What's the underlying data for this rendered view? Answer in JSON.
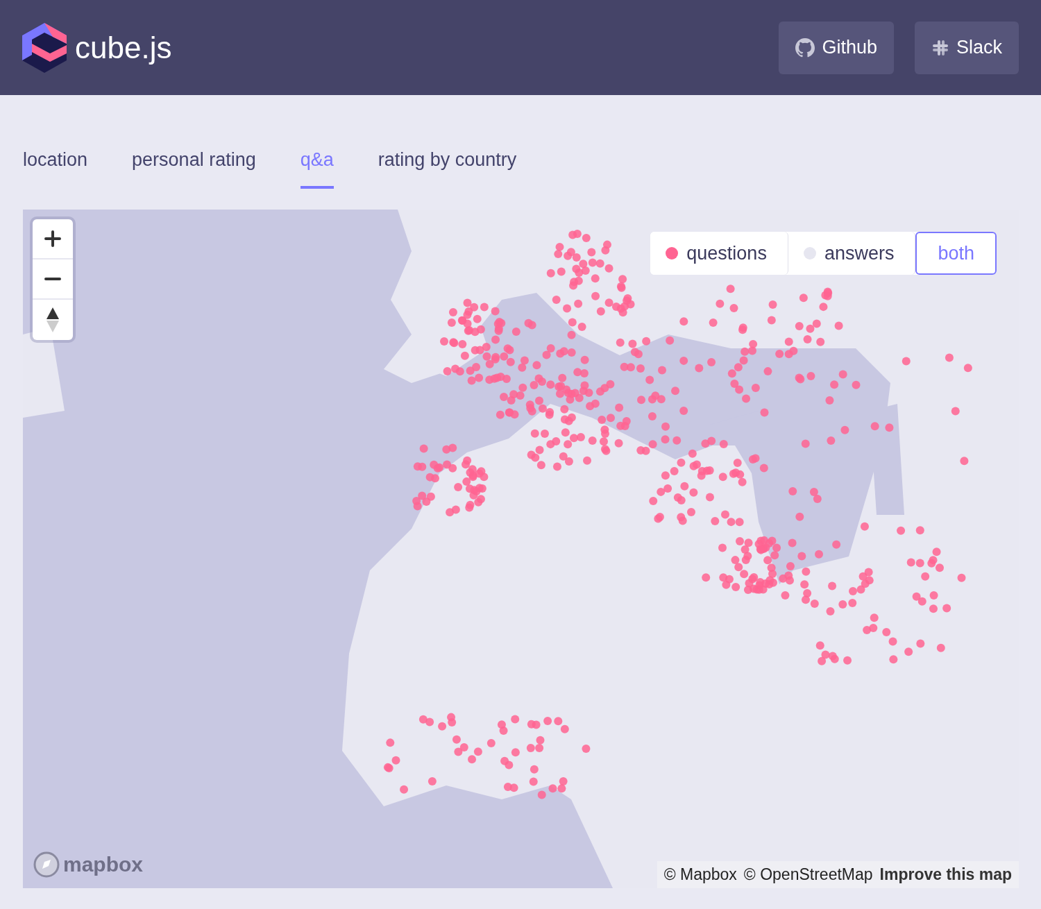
{
  "header": {
    "logo_text": "cube.js",
    "buttons": [
      {
        "kind": "github",
        "label": "Github"
      },
      {
        "kind": "slack",
        "label": "Slack"
      }
    ]
  },
  "tabs": [
    {
      "label": "location",
      "selected": false
    },
    {
      "label": "personal rating",
      "selected": false
    },
    {
      "label": "q&a",
      "selected": true
    },
    {
      "label": "rating by country",
      "selected": false
    }
  ],
  "map": {
    "zoom_controls": [
      {
        "kind": "zoom-in"
      },
      {
        "kind": "zoom-out"
      },
      {
        "kind": "compass"
      }
    ],
    "legend": [
      {
        "label": "questions",
        "selected": false,
        "color": "#ff6492"
      },
      {
        "label": "answers",
        "selected": false,
        "color": "#e6e6f0"
      },
      {
        "label": "both",
        "selected": true
      }
    ],
    "logo_text": "mapbox",
    "attribution": [
      "© Mapbox",
      "© OpenStreetMap",
      "Improve this map"
    ]
  }
}
